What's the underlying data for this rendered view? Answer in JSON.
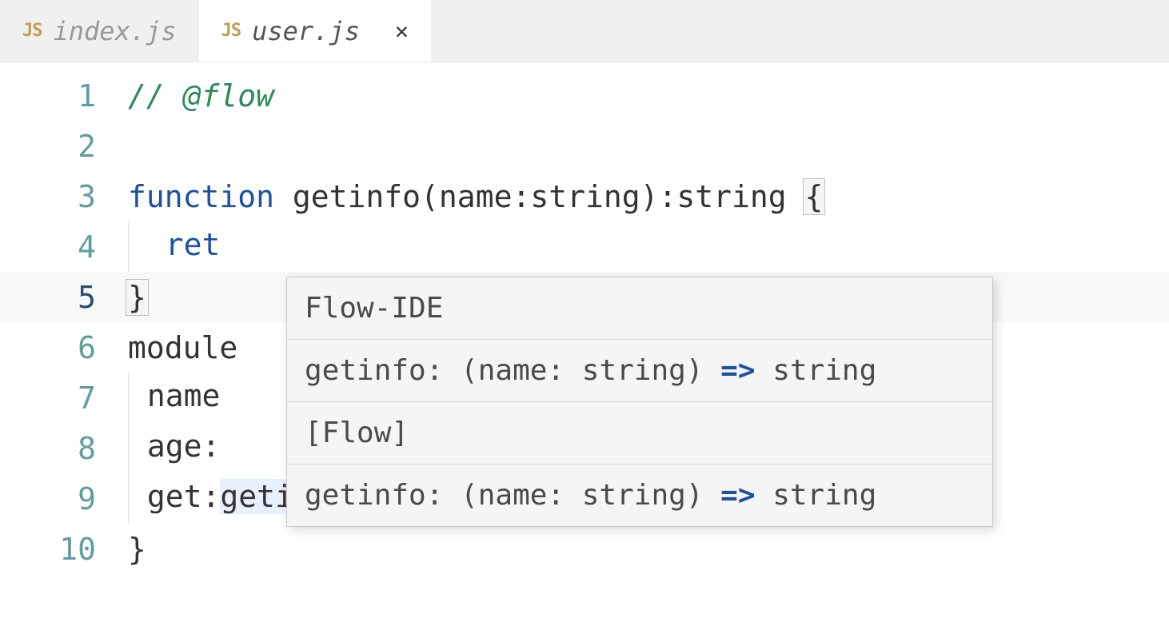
{
  "tabs": [
    {
      "icon": "JS",
      "label": "index.js",
      "active": false,
      "closeable": false
    },
    {
      "icon": "JS",
      "label": "user.js",
      "active": true,
      "closeable": true
    }
  ],
  "lines": {
    "l1_num": "1",
    "l1_comment": "// @flow",
    "l2_num": "2",
    "l3_num": "3",
    "l3_kw": "function",
    "l3_rest": " getinfo(name:string):string ",
    "l3_brace": "{",
    "l4_num": "4",
    "l4_kw": "ret",
    "l5_num": "5",
    "l5_brace": "}",
    "l6_num": "6",
    "l6_text": "module",
    "l7_num": "7",
    "l7_text": "name",
    "l8_num": "8",
    "l8_text": "age:",
    "l9_num": "9",
    "l9_text1": "get:",
    "l9_text2": "getinfo",
    "l10_num": "10",
    "l10_text": "}"
  },
  "tooltip": {
    "header1": "Flow-IDE",
    "sig1_a": "getinfo: (name: string) ",
    "sig1_arrow": "=>",
    "sig1_b": " string",
    "header2": "[Flow]",
    "sig2_a": "getinfo: (name: string) ",
    "sig2_arrow": "=>",
    "sig2_b": " string"
  }
}
